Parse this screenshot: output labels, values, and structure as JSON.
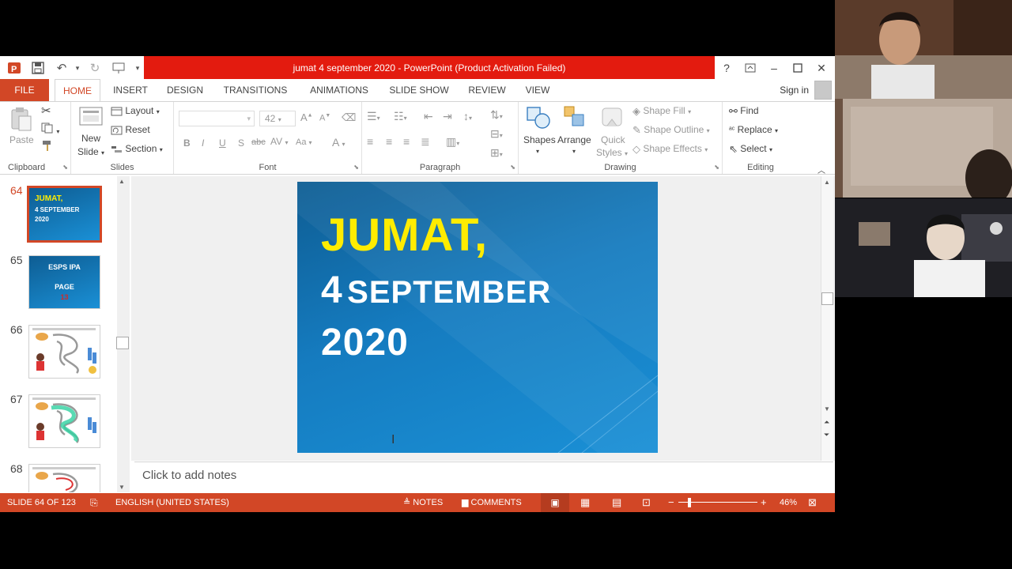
{
  "window": {
    "title": "jumat 4 september 2020 -  PowerPoint (Product Activation Failed)"
  },
  "tabs": [
    "FILE",
    "HOME",
    "INSERT",
    "DESIGN",
    "TRANSITIONS",
    "ANIMATIONS",
    "SLIDE SHOW",
    "REVIEW",
    "VIEW"
  ],
  "signin": "Sign in",
  "ribbon": {
    "clipboard": {
      "label": "Clipboard",
      "paste": "Paste"
    },
    "slides": {
      "label": "Slides",
      "new_slide_1": "New",
      "new_slide_2": "Slide",
      "layout": "Layout",
      "reset": "Reset",
      "section": "Section"
    },
    "font": {
      "label": "Font",
      "size": "42",
      "bold": "B",
      "italic": "I",
      "underline": "U",
      "shadow": "S",
      "strike": "abc"
    },
    "paragraph": {
      "label": "Paragraph"
    },
    "drawing": {
      "label": "Drawing",
      "shapes": "Shapes",
      "arrange": "Arrange",
      "quick_1": "Quick",
      "quick_2": "Styles",
      "fill": "Shape Fill",
      "outline": "Shape Outline",
      "effects": "Shape Effects"
    },
    "editing": {
      "label": "Editing",
      "find": "Find",
      "replace": "Replace",
      "select": "Select"
    }
  },
  "thumbnails": {
    "numbers": [
      "64",
      "65",
      "66",
      "67",
      "68"
    ],
    "t64": {
      "line1": "JUMAT,",
      "line2": "4 SEPTEMBER",
      "line3": "2020"
    },
    "t65": {
      "line1": "ESPS IPA",
      "line2": "PAGE",
      "line3": "13"
    }
  },
  "slide": {
    "line1": "JUMAT,",
    "line2_num": "4",
    "line2_text": "SEPTEMBER",
    "line3": "2020"
  },
  "notes_placeholder": "Click to add notes",
  "status": {
    "slide_of": "SLIDE 64 OF 123",
    "language": "ENGLISH (UNITED STATES)",
    "notes": "NOTES",
    "comments": "COMMENTS",
    "zoom": "46%",
    "zoom_level": 0.46
  },
  "colors": {
    "accent": "#d24726",
    "title_red": "#e31b0f",
    "slide_yellow": "#ffec00"
  }
}
